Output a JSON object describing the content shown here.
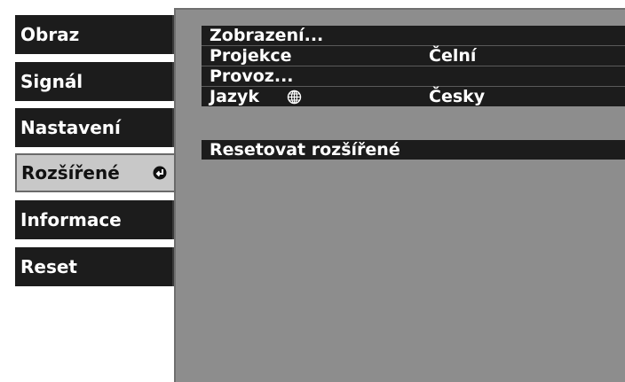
{
  "menu": {
    "tabs": [
      {
        "label": "Obraz"
      },
      {
        "label": "Signál"
      },
      {
        "label": "Nastavení"
      },
      {
        "label": "Rozšířené",
        "active": true
      },
      {
        "label": "Informace"
      },
      {
        "label": "Reset"
      }
    ]
  },
  "panel": {
    "items": [
      {
        "label": "Zobrazení...",
        "value": ""
      },
      {
        "label": "Projekce",
        "value": "Čelní"
      },
      {
        "label": "Provoz...",
        "value": ""
      },
      {
        "label": "Jazyk",
        "value": "Česky",
        "icon": "globe-icon"
      },
      {
        "label": "Resetovat rozšířené",
        "value": ""
      }
    ]
  },
  "colors": {
    "tab_bg": "#1c1c1c",
    "tab_active_bg": "#c8c8c8",
    "panel_bg": "#8d8d8d",
    "text": "#ffffff"
  },
  "icons": {
    "active_tab_icon": "enter-icon"
  }
}
